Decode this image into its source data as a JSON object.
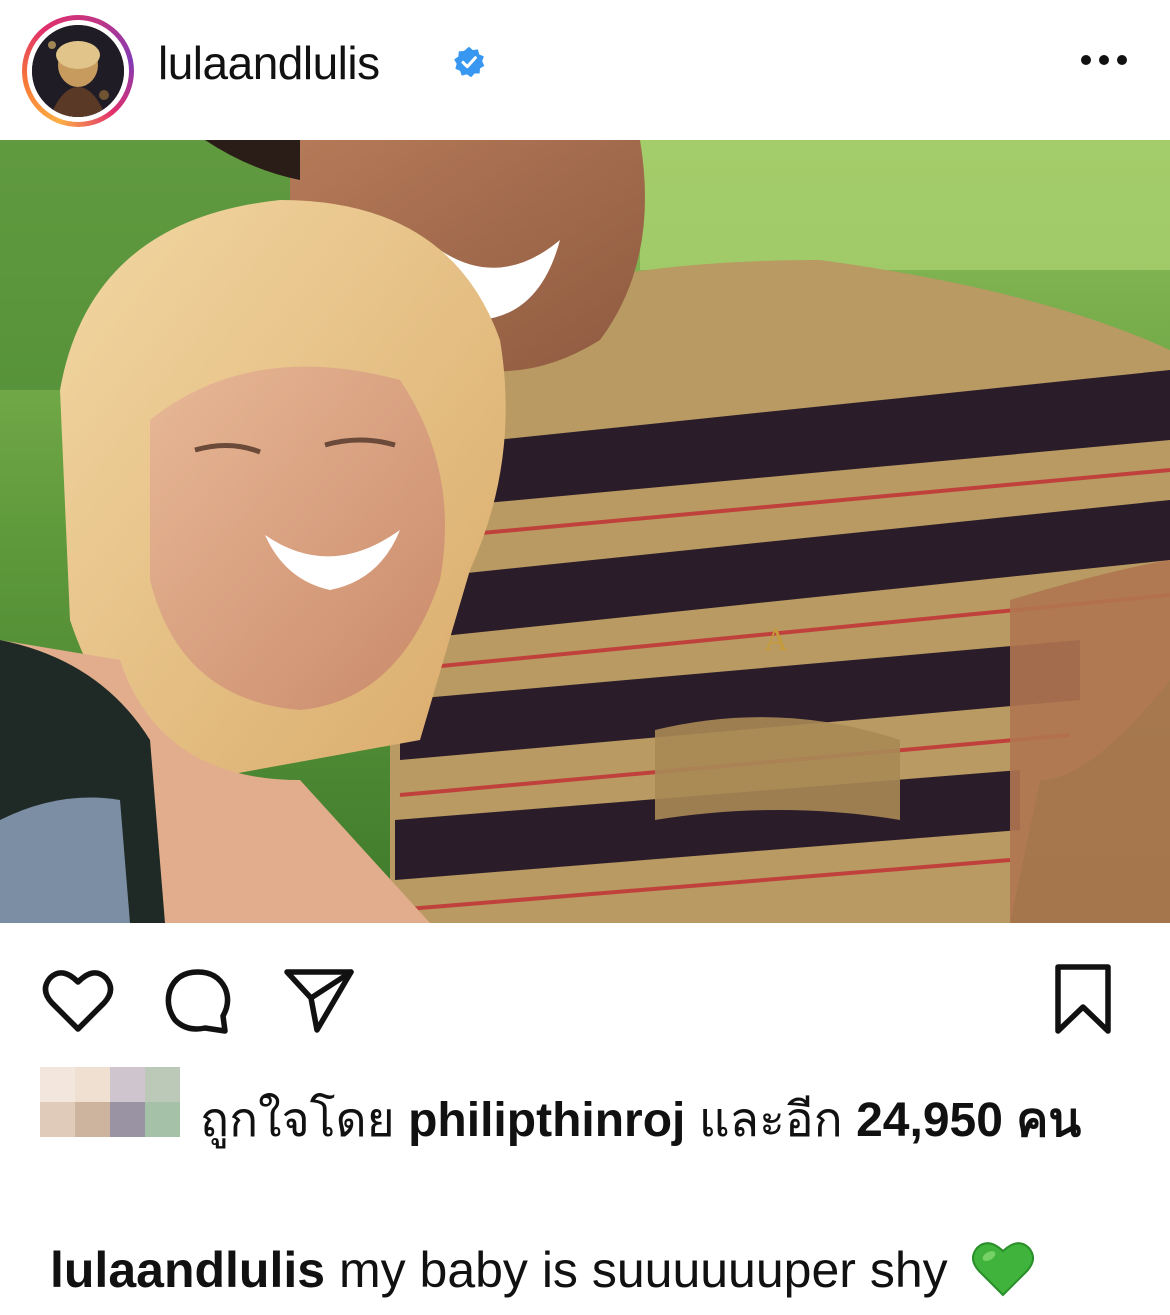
{
  "post": {
    "username": "lulaandlulis",
    "verified": true,
    "photo_alt": "",
    "actions": {
      "like_icon": "heart-outline-icon",
      "comment_icon": "speech-bubble-icon",
      "share_icon": "paper-plane-icon",
      "save_icon": "bookmark-icon",
      "more_icon": "ellipsis-icon"
    },
    "likes": {
      "prefix": "ถูกใจโดย",
      "liked_by": "philipthinroj",
      "connector": "และอีก",
      "count": "24,950",
      "suffix": "คน"
    },
    "caption": {
      "username": "lulaandlulis",
      "text": "my baby is suuuuuuper shy",
      "emoji": "green-heart-icon"
    }
  },
  "colors": {
    "text": "#111111",
    "verified_blue": "#3897f0",
    "emoji_green": "#3fb33b",
    "background": "#ffffff"
  }
}
